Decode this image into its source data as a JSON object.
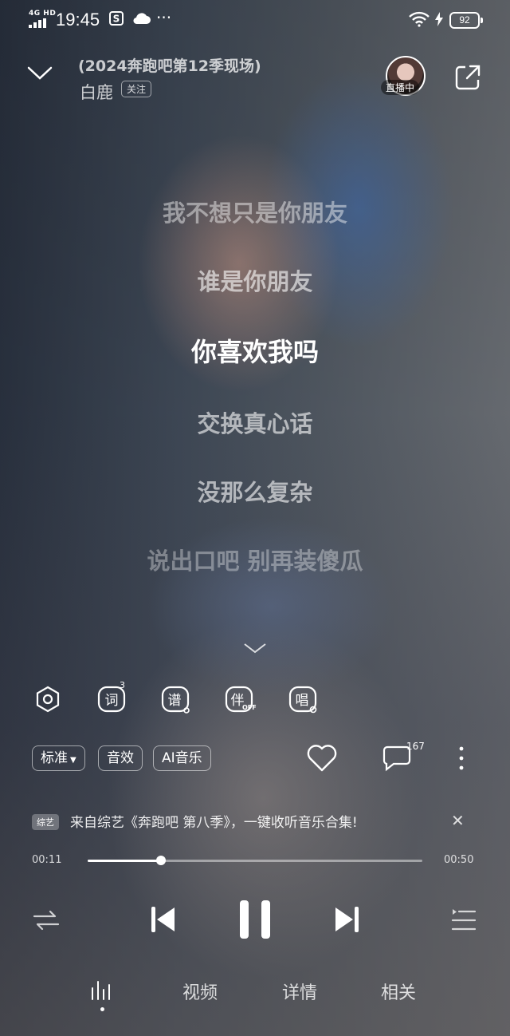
{
  "status_bar": {
    "network": "4G HD",
    "time": "19:45",
    "battery": "92"
  },
  "header": {
    "song_title": "(2024奔跑吧第12季现场)",
    "artist": "白鹿",
    "follow_label": "关注",
    "live_label": "直播中"
  },
  "lyrics": [
    "我不想只是你朋友",
    "谁是你朋友",
    "你喜欢我吗",
    "交换真心话",
    "没那么复杂",
    "说出口吧 别再装傻瓜"
  ],
  "current_lyric_index": 2,
  "tools": [
    {
      "name": "effect",
      "label": ""
    },
    {
      "name": "lyrics",
      "label": "词",
      "badge": "3"
    },
    {
      "name": "score",
      "label": "谱"
    },
    {
      "name": "accompaniment",
      "label": "伴",
      "badge": "OFF"
    },
    {
      "name": "sing",
      "label": "唱"
    }
  ],
  "quality": {
    "standard_label": "标准",
    "effect_label": "音效",
    "ai_label": "AI音乐"
  },
  "comment_count": "167",
  "banner": {
    "badge": "综艺",
    "text": "来自综艺《奔跑吧 第八季》，一键收听音乐合集!"
  },
  "progress": {
    "current": "00:11",
    "total": "00:50",
    "fraction": 0.22
  },
  "tabs": [
    "视频",
    "详情",
    "相关"
  ]
}
